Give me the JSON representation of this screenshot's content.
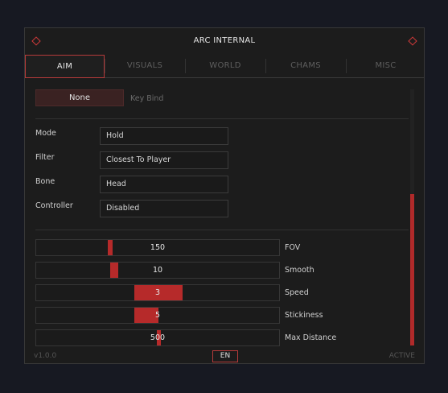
{
  "window": {
    "title": "ARC INTERNAL"
  },
  "tabs": [
    {
      "label": "AIM",
      "active": true
    },
    {
      "label": "VISUALS",
      "active": false
    },
    {
      "label": "WORLD",
      "active": false
    },
    {
      "label": "CHAMS",
      "active": false
    },
    {
      "label": "MISC",
      "active": false
    }
  ],
  "keybind": {
    "button_label": "None",
    "label": "Key Bind"
  },
  "settings": [
    {
      "label": "Mode",
      "value": "Hold"
    },
    {
      "label": "Filter",
      "value": "Closest To Player"
    },
    {
      "label": "Bone",
      "value": "Head"
    },
    {
      "label": "Controller",
      "value": "Disabled"
    }
  ],
  "sliders": [
    {
      "label": "FOV",
      "value": "150"
    },
    {
      "label": "Smooth",
      "value": "10"
    },
    {
      "label": "Speed",
      "value": "3"
    },
    {
      "label": "Stickiness",
      "value": "5"
    },
    {
      "label": "Max Distance",
      "value": "500"
    }
  ],
  "footer": {
    "version": "v1.0.0",
    "language": "EN",
    "status": "ACTIVE"
  },
  "colors": {
    "accent": "#b62a2a",
    "background": "#1c1c1c"
  }
}
